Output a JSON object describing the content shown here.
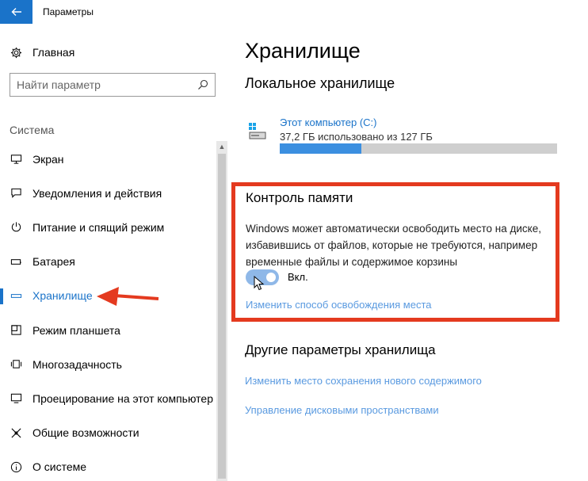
{
  "window": {
    "title": "Параметры"
  },
  "sidebar": {
    "home_label": "Главная",
    "search_placeholder": "Найти параметр",
    "section_label": "Система",
    "items": [
      {
        "label": "Экран",
        "icon": "display-icon"
      },
      {
        "label": "Уведомления и действия",
        "icon": "notifications-icon"
      },
      {
        "label": "Питание и спящий режим",
        "icon": "power-icon"
      },
      {
        "label": "Батарея",
        "icon": "battery-icon"
      },
      {
        "label": "Хранилище",
        "icon": "storage-icon",
        "active": true
      },
      {
        "label": "Режим планшета",
        "icon": "tablet-mode-icon"
      },
      {
        "label": "Многозадачность",
        "icon": "multitasking-icon"
      },
      {
        "label": "Проецирование на этот компьютер",
        "icon": "projecting-icon"
      },
      {
        "label": "Общие возможности",
        "icon": "shared-experiences-icon"
      },
      {
        "label": "О системе",
        "icon": "about-icon"
      }
    ]
  },
  "main": {
    "title": "Хранилище",
    "local_heading": "Локальное хранилище",
    "drive": {
      "name": "Этот компьютер (C:)",
      "usage": "37,2 ГБ использовано из 127 ГБ",
      "used_fraction": 0.293
    },
    "storage_sense": {
      "title": "Контроль памяти",
      "description": "Windows может автоматически освободить место на диске, избавившись от файлов, которые не требуются, например временные файлы и содержимое корзины",
      "toggle_state": "Вкл.",
      "toggle_on": true,
      "link": "Изменить способ освобождения места"
    },
    "other_heading": "Другие параметры хранилища",
    "other_links": [
      "Изменить место сохранения нового содержимого",
      "Управление дисковыми пространствами"
    ]
  },
  "colors": {
    "accent": "#1a73c9",
    "link": "#5a9ae0",
    "annotation": "#e43a1f"
  }
}
